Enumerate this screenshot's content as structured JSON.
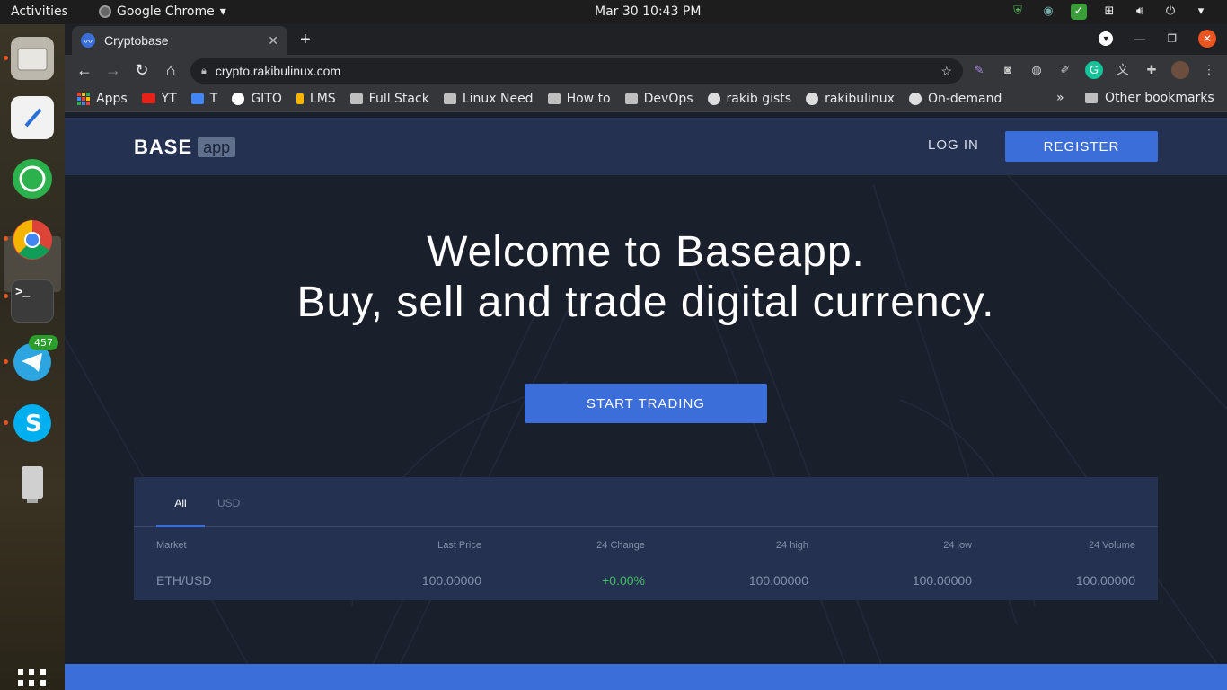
{
  "system": {
    "activities": "Activities",
    "app_name": "Google Chrome",
    "app_menu_arrow": "▾",
    "clock": "Mar 30  10:43 PM"
  },
  "dock": {
    "telegram_badge": "457"
  },
  "browser": {
    "tab_title": "Cryptobase",
    "new_tab": "+",
    "url": "crypto.rakibulinux.com",
    "bookmarks": [
      "Apps",
      "YT",
      "T",
      "GITO",
      "LMS",
      "Full Stack",
      "Linux Need",
      "How to",
      "DevOps",
      "rakib gists",
      "rakibulinux",
      "On-demand"
    ],
    "more": "»",
    "other_bookmarks": "Other bookmarks"
  },
  "site": {
    "logo_main": "BASE",
    "logo_sub": "app",
    "login": "LOG IN",
    "register": "REGISTER",
    "hero_line1": "Welcome to Baseapp.",
    "hero_line2": "Buy, sell and trade digital currency.",
    "cta": "START TRADING",
    "accent": "#3b6ed8",
    "market": {
      "tabs": [
        "All",
        "USD"
      ],
      "columns": [
        "Market",
        "Last Price",
        "24 Change",
        "24 high",
        "24 low",
        "24 Volume"
      ],
      "rows": [
        [
          "ETH/USD",
          "100.00000",
          "+0.00%",
          "100.00000",
          "100.00000",
          "100.00000"
        ]
      ]
    }
  }
}
